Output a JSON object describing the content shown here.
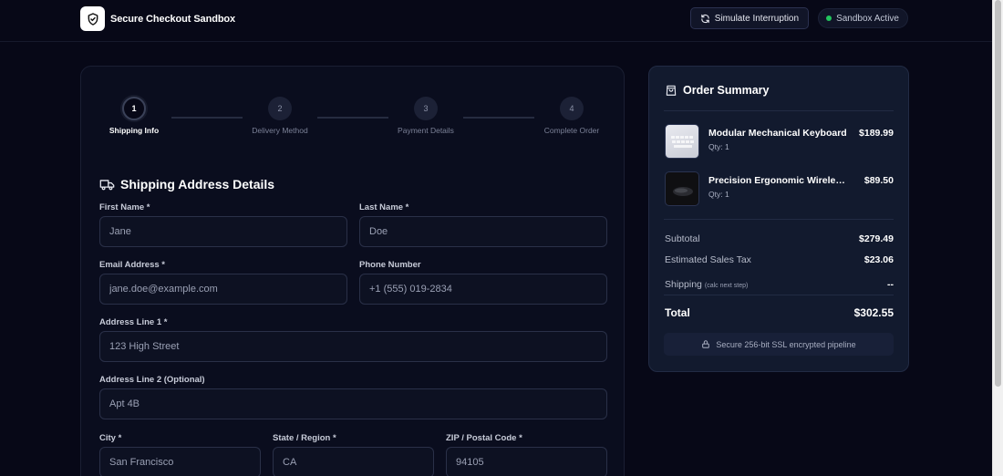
{
  "app": {
    "title": "Secure Checkout Sandbox"
  },
  "header": {
    "simulate_label": "Simulate Interruption",
    "sandbox_status": "Sandbox Active",
    "status_color": "#22c55e"
  },
  "stepper": {
    "current_step": 1,
    "steps": [
      {
        "number": "1",
        "label": "Shipping Info"
      },
      {
        "number": "2",
        "label": "Delivery Method"
      },
      {
        "number": "3",
        "label": "Payment Details"
      },
      {
        "number": "4",
        "label": "Complete Order"
      }
    ]
  },
  "form": {
    "section_title": "Shipping Address Details",
    "fields": {
      "first_name": {
        "label": "First Name *",
        "placeholder": "Jane"
      },
      "last_name": {
        "label": "Last Name *",
        "placeholder": "Doe"
      },
      "email": {
        "label": "Email Address *",
        "placeholder": "jane.doe@example.com"
      },
      "phone": {
        "label": "Phone Number",
        "placeholder": "+1 (555) 019-2834"
      },
      "address1": {
        "label": "Address Line 1 *",
        "placeholder": "123 High Street"
      },
      "address2": {
        "label": "Address Line 2 (Optional)",
        "placeholder": "Apt 4B"
      },
      "city": {
        "label": "City *",
        "placeholder": "San Francisco"
      },
      "state": {
        "label": "State / Region *",
        "placeholder": "CA"
      },
      "zip": {
        "label": "ZIP / Postal Code *",
        "placeholder": "94105"
      }
    }
  },
  "summary": {
    "title": "Order Summary",
    "items": [
      {
        "name": "Modular Mechanical Keyboard",
        "qty": "Qty: 1",
        "price": "$189.99"
      },
      {
        "name": "Precision Ergonomic Wireless Mouse",
        "qty": "Qty: 1",
        "price": "$89.50"
      }
    ],
    "subtotal": {
      "label": "Subtotal",
      "value": "$279.49"
    },
    "tax": {
      "label": "Estimated Sales Tax",
      "value": "$23.06"
    },
    "shipping": {
      "label": "Shipping",
      "note": "(calc next step)",
      "value": "--"
    },
    "total": {
      "label": "Total",
      "value": "$302.55"
    },
    "secure_note": "Secure 256-bit SSL encrypted pipeline"
  }
}
